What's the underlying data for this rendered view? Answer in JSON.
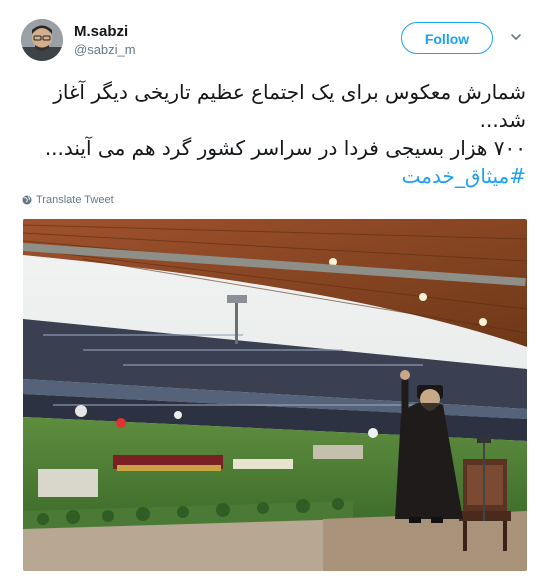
{
  "user": {
    "display_name": "M.sabzi",
    "handle": "@sabzi_m"
  },
  "actions": {
    "follow_label": "Follow",
    "more_icon": "chevron-down-icon"
  },
  "tweet": {
    "line1": "شمارش معکوس برای یک اجتماع عظیم تاریخی دیگر آغاز",
    "line2": "شد...",
    "line3": "۷۰۰ هزار بسیجی فردا در سراسر کشور گرد هم می آیند...",
    "hashtag": "#میثاق_خدمت"
  },
  "translate": {
    "label": "Translate Tweet",
    "icon": "globe-icon"
  },
  "colors": {
    "accent": "#1da1f2",
    "secondary_text": "#657786",
    "primary_text": "#14171a"
  }
}
